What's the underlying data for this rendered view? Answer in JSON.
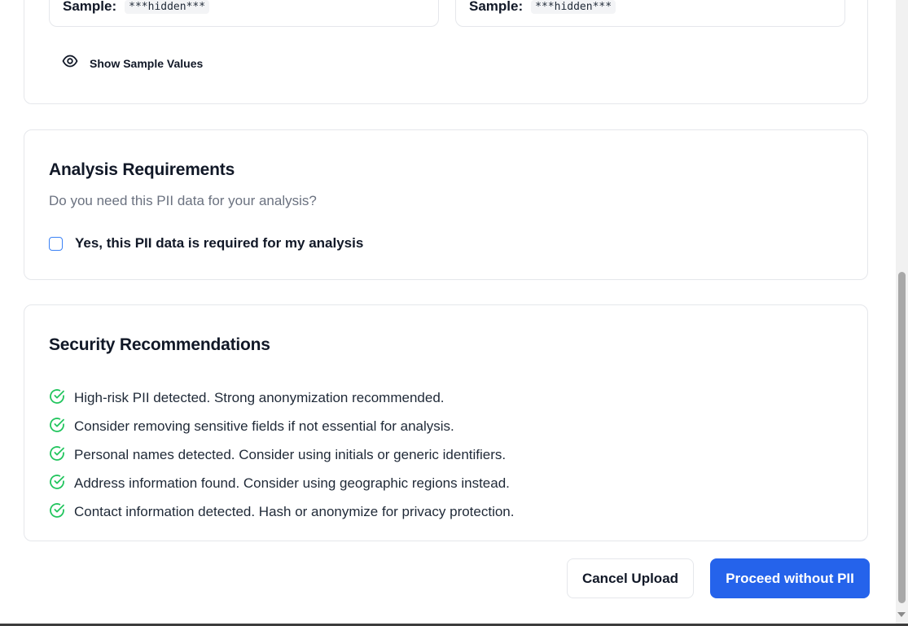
{
  "samples": {
    "left": {
      "label": "Sample:",
      "value": "***hidden***"
    },
    "right": {
      "label": "Sample:",
      "value": "***hidden***"
    },
    "toggle_label": "Show Sample Values"
  },
  "analysis": {
    "title": "Analysis Requirements",
    "question": "Do you need this PII data for your analysis?",
    "checkbox_label": "Yes, this PII data is required for my analysis",
    "checkbox_checked": false
  },
  "security": {
    "title": "Security Recommendations",
    "recommendations": [
      "High-risk PII detected. Strong anonymization recommended.",
      "Consider removing sensitive fields if not essential for analysis.",
      "Personal names detected. Consider using initials or generic identifiers.",
      "Address information found. Consider using geographic regions instead.",
      "Contact information detected. Hash or anonymize for privacy protection."
    ],
    "icon": "check-circle-icon",
    "icon_color": "#22c55e"
  },
  "actions": {
    "cancel_label": "Cancel Upload",
    "proceed_label": "Proceed without PII"
  },
  "colors": {
    "primary": "#2563eb",
    "checkbox_border": "#3b82f6",
    "muted_text": "#6b7280",
    "border": "#e5e7eb"
  }
}
